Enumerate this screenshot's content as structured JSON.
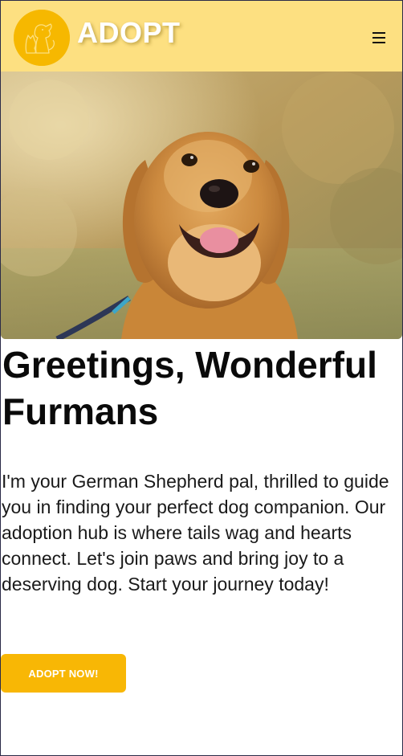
{
  "header": {
    "brand": "ADOPT",
    "logo_icon": "dog-and-cat-icon",
    "menu_icon": "hamburger-menu-icon",
    "background": "#fde081",
    "logo_color": "#f6b800"
  },
  "hero": {
    "image": "golden-retriever-photo"
  },
  "main": {
    "title": "Greetings, Wonderful Furmans",
    "intro": "I'm your German Shepherd pal, thrilled to guide you in finding your perfect dog companion. Our adoption hub is where tails wag and hearts connect. Let's join paws and bring joy to a deserving dog. Start your journey today!",
    "cta_label": "ADOPT NOW!",
    "accent": "#f8b705"
  }
}
